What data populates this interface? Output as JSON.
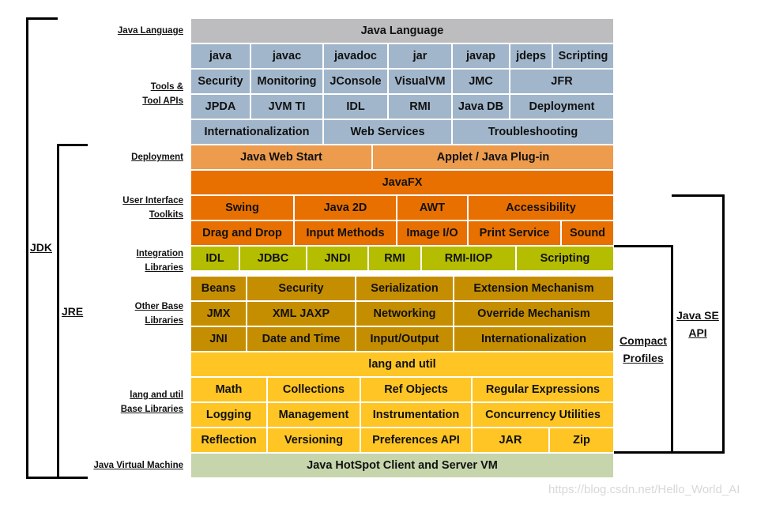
{
  "colors": {
    "java_language": "#bdbdbf",
    "tools": "#a1b6cb",
    "deployment": "#ed9b4d",
    "ui_toolkits": "#e87000",
    "integration": "#b5bd00",
    "other_base": "#c58e00",
    "lang_util": "#fec525",
    "jvm": "#c6d5ab"
  },
  "row_labels": {
    "java_language": [
      "Java Language"
    ],
    "tools": [
      "Tools &",
      "Tool APIs"
    ],
    "deployment": [
      "Deployment"
    ],
    "ui_toolkits": [
      "User Interface",
      "Toolkits"
    ],
    "integration": [
      "Integration",
      "Libraries"
    ],
    "other_base": [
      "Other Base",
      "Libraries"
    ],
    "lang_util": [
      "lang and util",
      "Base Libraries"
    ],
    "jvm": [
      "Java Virtual Machine"
    ]
  },
  "brackets": {
    "jdk": "JDK",
    "jre": "JRE",
    "compact_profiles": [
      "Compact",
      "Profiles"
    ],
    "java_se_api": [
      "Java SE",
      "API"
    ]
  },
  "rows": [
    {
      "group": "java_language",
      "cells": [
        "Java Language"
      ]
    },
    {
      "group": "tools",
      "cells": [
        "java",
        "javac",
        "javadoc",
        "jar",
        "javap",
        "jdeps",
        "Scripting"
      ]
    },
    {
      "group": "tools",
      "cells": [
        "Security",
        "Monitoring",
        "JConsole",
        "VisualVM",
        "JMC",
        "JFR"
      ]
    },
    {
      "group": "tools",
      "cells": [
        "JPDA",
        "JVM TI",
        "IDL",
        "RMI",
        "Java DB",
        "Deployment"
      ]
    },
    {
      "group": "tools",
      "cells": [
        "Internationalization",
        "Web Services",
        "Troubleshooting"
      ]
    },
    {
      "group": "deployment",
      "cells": [
        "Java Web Start",
        "Applet / Java Plug-in"
      ]
    },
    {
      "group": "ui_toolkits",
      "cells": [
        "JavaFX"
      ]
    },
    {
      "group": "ui_toolkits",
      "cells": [
        "Swing",
        "Java 2D",
        "AWT",
        "Accessibility"
      ]
    },
    {
      "group": "ui_toolkits",
      "cells": [
        "Drag and Drop",
        "Input Methods",
        "Image I/O",
        "Print Service",
        "Sound"
      ]
    },
    {
      "group": "integration",
      "cells": [
        "IDL",
        "JDBC",
        "JNDI",
        "RMI",
        "RMI-IIOP",
        "Scripting"
      ]
    },
    {
      "group": "other_base",
      "cells": [
        "Beans",
        "Security",
        "Serialization",
        "Extension Mechanism"
      ]
    },
    {
      "group": "other_base",
      "cells": [
        "JMX",
        "XML JAXP",
        "Networking",
        "Override Mechanism"
      ]
    },
    {
      "group": "other_base",
      "cells": [
        "JNI",
        "Date and Time",
        "Input/Output",
        "Internationalization"
      ]
    },
    {
      "group": "lang_util",
      "cells": [
        "lang and util"
      ]
    },
    {
      "group": "lang_util",
      "cells": [
        "Math",
        "Collections",
        "Ref Objects",
        "Regular Expressions"
      ]
    },
    {
      "group": "lang_util",
      "cells": [
        "Logging",
        "Management",
        "Instrumentation",
        "Concurrency Utilities"
      ]
    },
    {
      "group": "lang_util",
      "cells": [
        "Reflection",
        "Versioning",
        "Preferences API",
        "JAR",
        "Zip"
      ]
    },
    {
      "group": "jvm",
      "cells": [
        "Java HotSpot Client and Server VM"
      ]
    }
  ],
  "watermark": "https://blog.csdn.net/Hello_World_AI"
}
